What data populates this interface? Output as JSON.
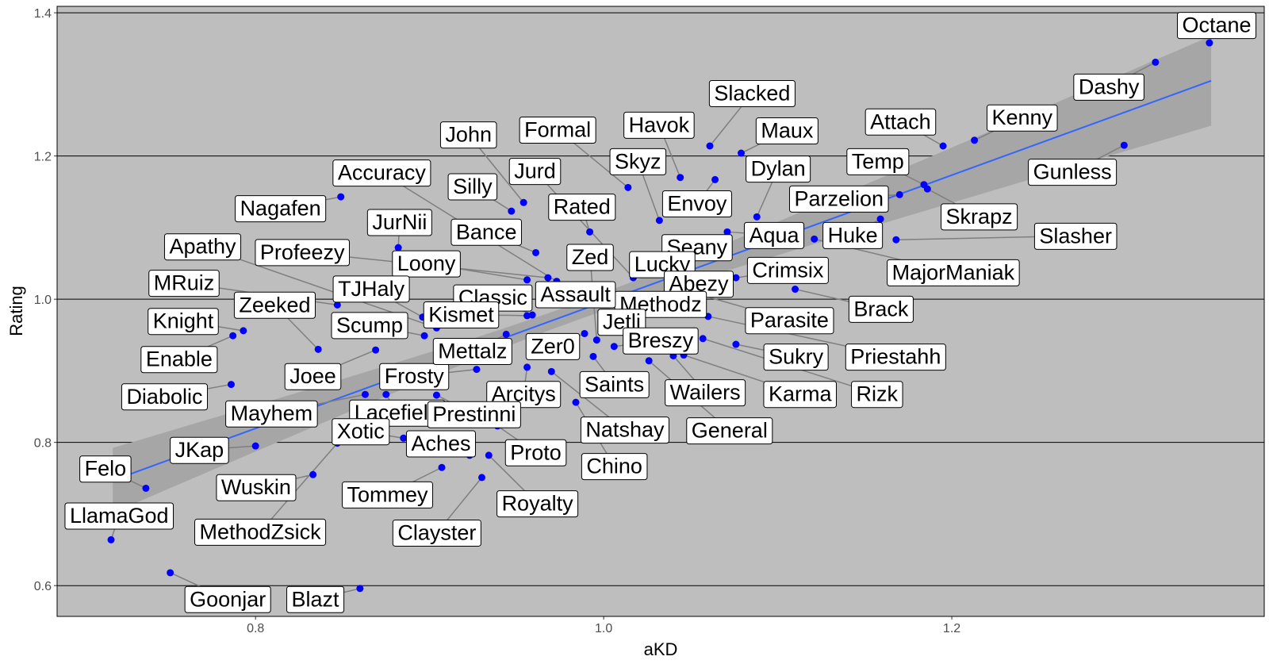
{
  "chart_data": {
    "type": "scatter",
    "title": "",
    "xlabel": "aKD",
    "ylabel": "Rating",
    "xlim": [
      0.686,
      1.3795
    ],
    "ylim": [
      0.557,
      1.409
    ],
    "xticks": [
      "0.8",
      "1.0",
      "1.2"
    ],
    "yticks": [
      "0.6",
      "0.8",
      "1.0",
      "1.2",
      "1.4"
    ],
    "grid": "horizontal major lines",
    "panel_background": "#bebebe",
    "point_color": "#0000ff",
    "smooth": {
      "method": "lm",
      "se": true,
      "color": "#3366ff",
      "band_color": "#a6a6a6",
      "x": [
        0.718,
        1.349
      ],
      "y": [
        0.747,
        1.305
      ]
    },
    "points": [
      {
        "name": "Octane",
        "x": 1.348,
        "y": 1.358
      },
      {
        "name": "Dashy",
        "x": 1.317,
        "y": 1.331
      },
      {
        "name": "Kenny",
        "x": 1.213,
        "y": 1.222
      },
      {
        "name": "Gunless",
        "x": 1.299,
        "y": 1.215
      },
      {
        "name": "Attach",
        "x": 1.195,
        "y": 1.214
      },
      {
        "name": "Temp",
        "x": 1.184,
        "y": 1.16
      },
      {
        "name": "Skrapz",
        "x": 1.186,
        "y": 1.154
      },
      {
        "name": "Parzelion",
        "x": 1.17,
        "y": 1.146
      },
      {
        "name": "Slasher",
        "x": 1.168,
        "y": 1.083
      },
      {
        "name": "Huke",
        "x": 1.159,
        "y": 1.112
      },
      {
        "name": "MajorManiak",
        "x": 1.121,
        "y": 1.084
      },
      {
        "name": "Brack",
        "x": 1.11,
        "y": 1.014
      },
      {
        "name": "Priestahh",
        "x": 1.06,
        "y": 0.976
      },
      {
        "name": "Rizk",
        "x": 1.057,
        "y": 0.945
      },
      {
        "name": "Karma",
        "x": 1.046,
        "y": 0.922
      },
      {
        "name": "Sukry",
        "x": 1.076,
        "y": 0.937
      },
      {
        "name": "Wailers",
        "x": 1.04,
        "y": 0.921
      },
      {
        "name": "General",
        "x": 1.026,
        "y": 0.914
      },
      {
        "name": "Crimsix",
        "x": 1.076,
        "y": 1.03
      },
      {
        "name": "Parasite",
        "x": 1.05,
        "y": 1.01
      },
      {
        "name": "Aqua",
        "x": 1.071,
        "y": 1.094
      },
      {
        "name": "Dylan",
        "x": 1.088,
        "y": 1.115
      },
      {
        "name": "Maux",
        "x": 1.079,
        "y": 1.204
      },
      {
        "name": "Slacked",
        "x": 1.061,
        "y": 1.214
      },
      {
        "name": "Havok",
        "x": 1.044,
        "y": 1.17
      },
      {
        "name": "Envoy",
        "x": 1.064,
        "y": 1.167
      },
      {
        "name": "Skyz",
        "x": 1.032,
        "y": 1.11
      },
      {
        "name": "Formal",
        "x": 1.014,
        "y": 1.156
      },
      {
        "name": "Seany",
        "x": 1.045,
        "y": 1.065
      },
      {
        "name": "Lucky",
        "x": 1.025,
        "y": 1.035
      },
      {
        "name": "Abezy",
        "x": 1.045,
        "y": 1.019
      },
      {
        "name": "Methodz",
        "x": 1.031,
        "y": 0.991
      },
      {
        "name": "Jurd",
        "x": 1.017,
        "y": 1.03
      },
      {
        "name": "Rated",
        "x": 0.992,
        "y": 1.094
      },
      {
        "name": "John",
        "x": 0.954,
        "y": 1.135
      },
      {
        "name": "Silly",
        "x": 0.947,
        "y": 1.123
      },
      {
        "name": "Bance",
        "x": 0.961,
        "y": 1.065
      },
      {
        "name": "Accuracy",
        "x": 0.973,
        "y": 1.025
      },
      {
        "name": "Profeezy",
        "x": 0.968,
        "y": 1.03
      },
      {
        "name": "Loony",
        "x": 0.956,
        "y": 1.027
      },
      {
        "name": "JurNii",
        "x": 0.882,
        "y": 1.072
      },
      {
        "name": "Classic",
        "x": 0.959,
        "y": 0.978
      },
      {
        "name": "Kismet",
        "x": 0.956,
        "y": 0.977
      },
      {
        "name": "Assault",
        "x": 0.979,
        "y": 1.006
      },
      {
        "name": "Zed",
        "x": 0.996,
        "y": 0.943
      },
      {
        "name": "Jetli",
        "x": 1.004,
        "y": 0.963
      },
      {
        "name": "Breszy",
        "x": 1.006,
        "y": 0.934
      },
      {
        "name": "Zer0",
        "x": 0.989,
        "y": 0.952
      },
      {
        "name": "Saints",
        "x": 0.994,
        "y": 0.92
      },
      {
        "name": "Natshay",
        "x": 0.97,
        "y": 0.899
      },
      {
        "name": "Chino",
        "x": 0.984,
        "y": 0.856
      },
      {
        "name": "Arcitys",
        "x": 0.956,
        "y": 0.905
      },
      {
        "name": "Frosty",
        "x": 0.927,
        "y": 0.902
      },
      {
        "name": "Mettalz",
        "x": 0.944,
        "y": 0.951
      },
      {
        "name": "Apathy",
        "x": 0.904,
        "y": 0.96
      },
      {
        "name": "TJHaly",
        "x": 0.896,
        "y": 0.975
      },
      {
        "name": "Scump",
        "x": 0.897,
        "y": 0.949
      },
      {
        "name": "MRuiz",
        "x": 0.847,
        "y": 0.992
      },
      {
        "name": "Zeeked",
        "x": 0.836,
        "y": 0.93
      },
      {
        "name": "Nagafen",
        "x": 0.849,
        "y": 1.143
      },
      {
        "name": "Knight",
        "x": 0.793,
        "y": 0.956
      },
      {
        "name": "Enable",
        "x": 0.787,
        "y": 0.949
      },
      {
        "name": "Joee",
        "x": 0.869,
        "y": 0.929
      },
      {
        "name": "Diabolic",
        "x": 0.786,
        "y": 0.881
      },
      {
        "name": "Mayhem",
        "x": 0.863,
        "y": 0.867
      },
      {
        "name": "Lacefield",
        "x": 0.875,
        "y": 0.867
      },
      {
        "name": "Prestinni",
        "x": 0.904,
        "y": 0.866
      },
      {
        "name": "Proto",
        "x": 0.939,
        "y": 0.823
      },
      {
        "name": "Xotic",
        "x": 0.885,
        "y": 0.806
      },
      {
        "name": "Aches",
        "x": 0.923,
        "y": 0.782
      },
      {
        "name": "MethodZsick",
        "x": 0.847,
        "y": 0.799
      },
      {
        "name": "Wuskin",
        "x": 0.833,
        "y": 0.755
      },
      {
        "name": "JKap",
        "x": 0.8,
        "y": 0.795
      },
      {
        "name": "Felo",
        "x": 0.737,
        "y": 0.736
      },
      {
        "name": "LlamaGod",
        "x": 0.717,
        "y": 0.664
      },
      {
        "name": "Goonjar",
        "x": 0.751,
        "y": 0.618
      },
      {
        "name": "Blazt",
        "x": 0.86,
        "y": 0.596
      },
      {
        "name": "Tommey",
        "x": 0.907,
        "y": 0.765
      },
      {
        "name": "Clayster",
        "x": 0.93,
        "y": 0.751
      },
      {
        "name": "Royalty",
        "x": 0.934,
        "y": 0.782
      }
    ]
  }
}
